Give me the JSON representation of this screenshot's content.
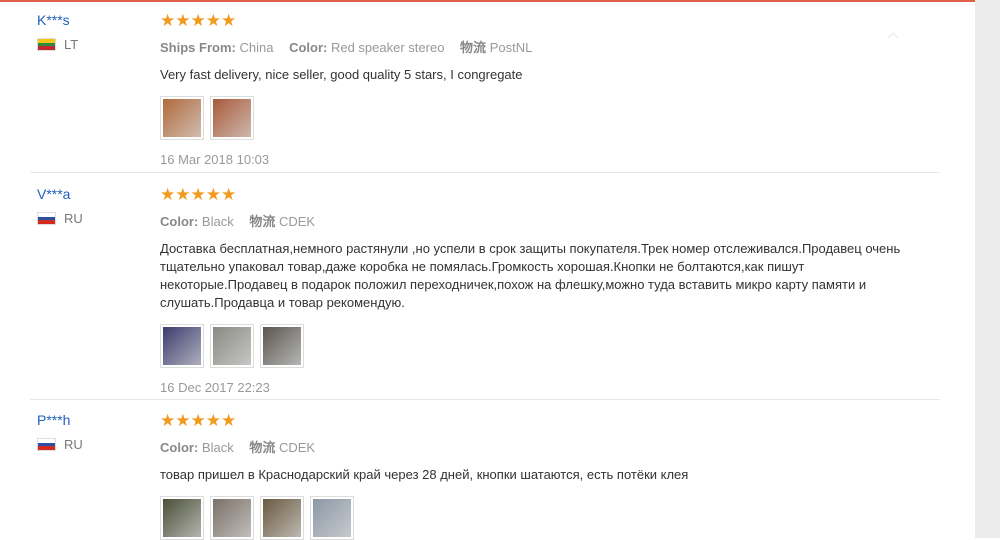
{
  "reviews": [
    {
      "user": "K***s",
      "country": "LT",
      "flag_colors": [
        "#f5c518",
        "#2e8b3d",
        "#c1272d"
      ],
      "stars": "★★★★★",
      "meta": [
        {
          "key": "Ships From:",
          "value": "China"
        },
        {
          "key": "Color:",
          "value": "Red speaker stereo"
        },
        {
          "key": "物流",
          "value": "PostNL"
        }
      ],
      "text": "Very fast delivery, nice seller, good quality 5 stars, I congregate",
      "thumbs": [
        {
          "icon": "photo-thumbnail",
          "color": "#b06a3c"
        },
        {
          "icon": "photo-thumbnail",
          "color": "#a85a3a"
        }
      ],
      "date": "16 Mar 2018 10:03"
    },
    {
      "user": "V***a",
      "country": "RU",
      "flag_colors": [
        "#ffffff",
        "#2c4fa3",
        "#d52b1e"
      ],
      "stars": "★★★★★",
      "meta": [
        {
          "key": "Color:",
          "value": "Black"
        },
        {
          "key": "物流",
          "value": "CDEK"
        }
      ],
      "text": "Доставка бесплатная,немного растянули ,но успели в срок защиты покупателя.Трек номер отслеживался.Продавец очень тщательно упаковал товар,даже коробка не помялась.Громкость хорошая.Кнопки не болтаются,как пишут некоторые.Продавец в подарок положил переходничек,похож на флешку,можно туда вставить микро карту памяти и слушать.Продавца и товар рекомендую.",
      "thumbs": [
        {
          "icon": "photo-thumbnail",
          "color": "#3c3c6e"
        },
        {
          "icon": "photo-thumbnail",
          "color": "#8a8a84"
        },
        {
          "icon": "photo-thumbnail",
          "color": "#5a5650"
        }
      ],
      "date": "16 Dec 2017 22:23"
    },
    {
      "user": "P***h",
      "country": "RU",
      "flag_colors": [
        "#ffffff",
        "#2c4fa3",
        "#d52b1e"
      ],
      "stars": "★★★★★",
      "meta": [
        {
          "key": "Color:",
          "value": "Black"
        },
        {
          "key": "物流",
          "value": "CDEK"
        }
      ],
      "text": "товар пришел в Краснодарский край через 28 дней, кнопки шатаются, есть потёки клея",
      "thumbs": [
        {
          "icon": "photo-thumbnail",
          "color": "#4a5038"
        },
        {
          "icon": "photo-thumbnail",
          "color": "#7a7068"
        },
        {
          "icon": "photo-thumbnail",
          "color": "#6a5a40"
        },
        {
          "icon": "photo-thumbnail",
          "color": "#8c98a6"
        }
      ]
    }
  ]
}
